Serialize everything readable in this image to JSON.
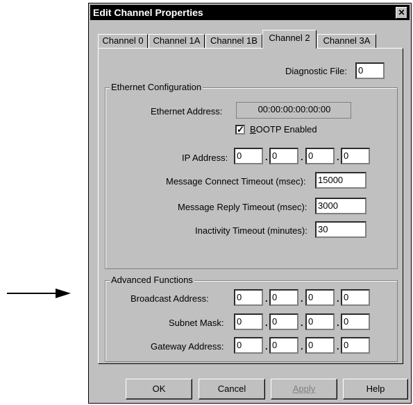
{
  "dialog": {
    "title": "Edit Channel Properties",
    "close_glyph": "✕"
  },
  "tabs": [
    {
      "label": "Channel 0",
      "active": false
    },
    {
      "label": "Channel 1A",
      "active": false
    },
    {
      "label": "Channel 1B",
      "active": false
    },
    {
      "label": "Channel 2",
      "active": true
    },
    {
      "label": "Channel 3A",
      "active": false
    }
  ],
  "diagnostic_file": {
    "label": "Diagnostic File:",
    "value": "0"
  },
  "ethernet": {
    "group_title": "Ethernet Configuration",
    "address_label": "Ethernet Address:",
    "address_value": "00:00:00:00:00:00",
    "bootp_label": "BOOTP Enabled",
    "bootp_checked": true,
    "ip_label": "IP Address:",
    "ip": [
      "0",
      "0",
      "0",
      "0"
    ],
    "connect_timeout_label": "Message Connect Timeout (msec):",
    "connect_timeout_value": "15000",
    "reply_timeout_label": "Message Reply Timeout (msec):",
    "reply_timeout_value": "3000",
    "inactivity_label": "Inactivity Timeout (minutes):",
    "inactivity_value": "30"
  },
  "advanced": {
    "group_title": "Advanced Functions",
    "broadcast_label": "Broadcast Address:",
    "broadcast": [
      "0",
      "0",
      "0",
      "0"
    ],
    "subnet_label": "Subnet Mask:",
    "subnet": [
      "0",
      "0",
      "0",
      "0"
    ],
    "gateway_label": "Gateway Address:",
    "gateway": [
      "0",
      "0",
      "0",
      "0"
    ]
  },
  "buttons": {
    "ok": "OK",
    "cancel": "Cancel",
    "apply": "Apply",
    "help": "Help"
  },
  "colors": {
    "face": "#c0c0c0",
    "titlebar": "#000000",
    "disabled_text": "#808080"
  },
  "icons": {
    "arrow": "right-arrow-icon",
    "close": "close-icon",
    "check": "checkmark-icon"
  }
}
